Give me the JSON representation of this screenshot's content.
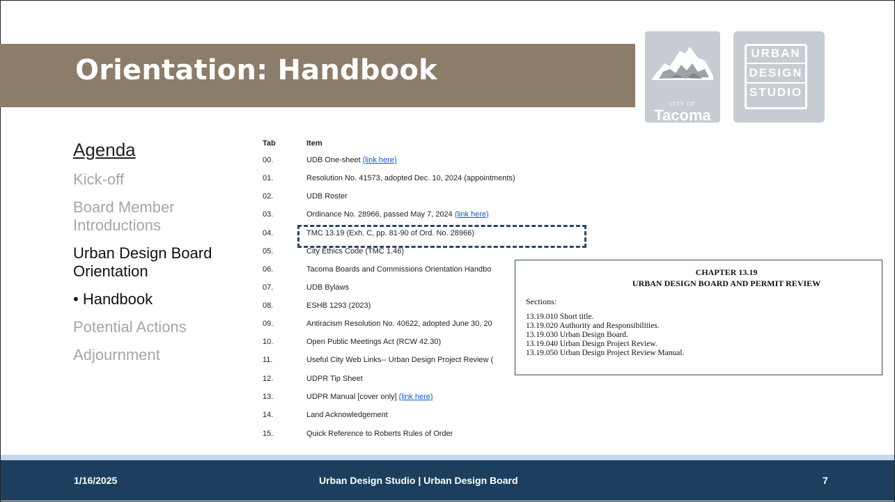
{
  "slide": {
    "title": "Orientation: Handbook",
    "logos": {
      "tacoma_small": "CITY OF",
      "tacoma_name": "Tacoma",
      "uds_lines": [
        "URBAN",
        "DESIGN",
        "STUDIO"
      ]
    }
  },
  "agenda": {
    "title": "Agenda",
    "items": [
      {
        "label": "Kick-off",
        "active": false
      },
      {
        "label": "Board Member Introductions",
        "active": false
      },
      {
        "label": "Urban Design Board Orientation",
        "active": true
      },
      {
        "label": "• Handbook",
        "active": true
      },
      {
        "label": "Potential Actions",
        "active": false
      },
      {
        "label": "Adjournment",
        "active": false
      }
    ]
  },
  "table": {
    "headers": {
      "tab": "Tab",
      "item": "Item"
    },
    "rows": [
      {
        "tab": "00.",
        "item": "UDB One-sheet ",
        "link": "(link here)"
      },
      {
        "tab": "01.",
        "item": "Resolution No. 41573, adopted Dec. 10, 2024 (appointments)",
        "link": ""
      },
      {
        "tab": "02.",
        "item": "UDB Roster",
        "link": ""
      },
      {
        "tab": "03.",
        "item": "Ordinance No. 28966, passed May 7, 2024 ",
        "link": "(link here)"
      },
      {
        "tab": "04.",
        "item": "TMC 13.19 (Exh. C, pp. 81-90 of Ord. No. 28966)",
        "link": ""
      },
      {
        "tab": "05.",
        "item": "City Ethics Code (TMC 1.46)",
        "link": ""
      },
      {
        "tab": "06.",
        "item": "Tacoma Boards and Commissions Orientation Handbo",
        "link": ""
      },
      {
        "tab": "07.",
        "item": "UDB Bylaws",
        "link": ""
      },
      {
        "tab": "08.",
        "item": "ESHB 1293 (2023)",
        "link": ""
      },
      {
        "tab": "09.",
        "item": "Antiracism Resolution No. 40622, adopted June 30, 20",
        "link": ""
      },
      {
        "tab": "10.",
        "item": "Open Public Meetings Act (RCW 42.30)",
        "link": ""
      },
      {
        "tab": "11.",
        "item": "Useful City Web Links-- Urban Design Project Review (",
        "link": ""
      },
      {
        "tab": "12.",
        "item": "UDPR Tip Sheet",
        "link": ""
      },
      {
        "tab": "13.",
        "item": "UDPR Manual [cover only] ",
        "link": "(link here)"
      },
      {
        "tab": "14.",
        "item": "Land Acknowledgement",
        "link": ""
      },
      {
        "tab": "15.",
        "item": "Quick Reference to Roberts Rules of Order",
        "link": ""
      }
    ]
  },
  "popup": {
    "heading1": "CHAPTER 13.19",
    "heading2": "URBAN DESIGN BOARD AND PERMIT REVIEW",
    "sections_label": "Sections:",
    "sections": [
      "13.19.010 Short title.",
      "13.19.020 Authority and Responsibilities.",
      "13.19.030 Urban Design Board.",
      "13.19.040 Urban Design Project Review.",
      "13.19.050 Urban Design Project Review Manual."
    ]
  },
  "footer": {
    "date": "1/16/2025",
    "center": "Urban Design Studio | Urban Design Board",
    "page": "7"
  },
  "colors": {
    "title_bar": "#8c7c6a",
    "footer": "#1d3f5f",
    "link": "#1155cc",
    "dash": "#27466b"
  }
}
